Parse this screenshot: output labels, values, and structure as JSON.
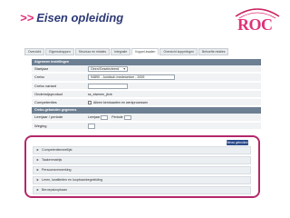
{
  "header": {
    "arrows": ">>",
    "title": "Eisen opleiding"
  },
  "logo": {
    "text": "ROC"
  },
  "tabs": [
    "Overzicht",
    "Eigenschappen",
    "Structuur en relaties",
    "Integratie",
    "Koppel-kwalen",
    "Overzicht koppelingen",
    "Behoefte relaties"
  ],
  "sections": {
    "general": "Algemene instellingen",
    "assessment": "Crebo-gebonden gegevens"
  },
  "fields": {
    "startjaar": {
      "label": "Startjaar",
      "value": "Geen/Geselecteerd"
    },
    "crebo": {
      "label": "Crebo",
      "value": "94890 - Juridisch medewerker - 2009"
    },
    "crebo_variant": {
      "label": "Crebo variant",
      "value": ""
    },
    "onderwijsproduct": {
      "label": "Onderwijsproduct",
      "value": "ss_eisenen_jbvb"
    },
    "competenties": {
      "label": "Competenties",
      "value": "Alleen kernkaarten en werkprocessen"
    },
    "leerjaar_periode": {
      "label": "Leerjaar / periode",
      "leerjaar_label": "Leerjaar",
      "periode_label": "Periode"
    },
    "weging": {
      "label": "Weging",
      "value": ""
    }
  },
  "add_button": "Nieuw gebruiken",
  "list_items": [
    "Competentiemeetlijst",
    "Taakenmatrijs",
    "Persoonsverwerking",
    "Leren, kwaliteiten en loopbaanbegeleiding",
    "Beroepsloopbaan"
  ],
  "colors": {
    "title_blue": "#2e3a78",
    "accent_magenta": "#e0307a",
    "highlight_border": "#b3286a",
    "section_gray": "#6d7f92",
    "button_blue": "#2a4a8a"
  }
}
